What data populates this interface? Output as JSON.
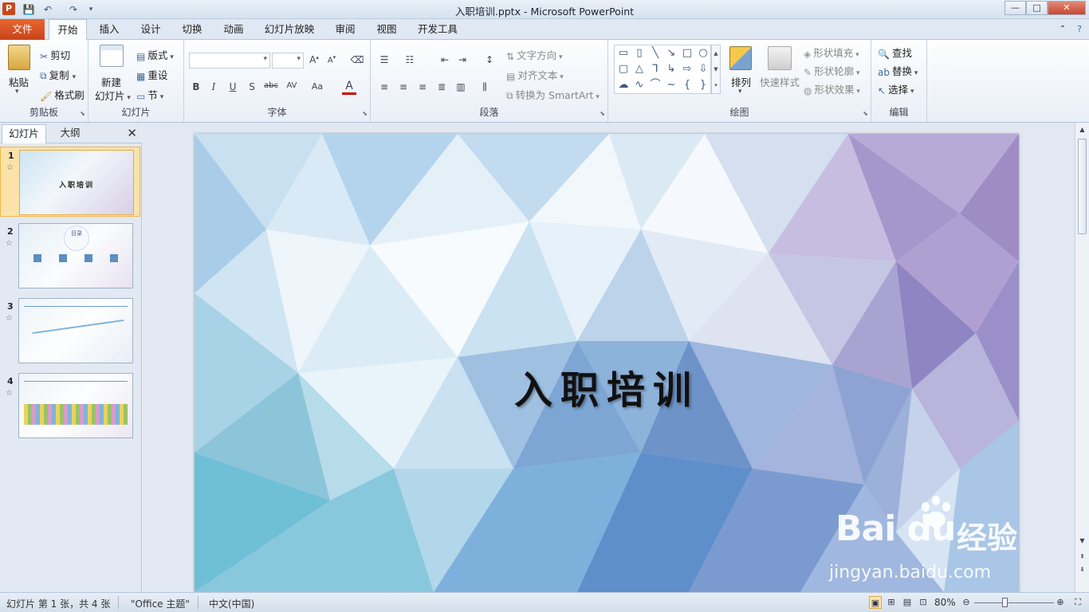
{
  "window": {
    "title": "入职培训.pptx - Microsoft PowerPoint",
    "app_icon_letter": "P",
    "minimize": "—",
    "maximize": "□",
    "close": "✕"
  },
  "tabs": [
    "文件",
    "开始",
    "插入",
    "设计",
    "切换",
    "动画",
    "幻灯片放映",
    "审阅",
    "视图",
    "开发工具"
  ],
  "active_tab": "开始",
  "ribbon": {
    "clipboard": {
      "label": "剪贴板",
      "paste": "粘贴",
      "cut": "剪切",
      "copy": "复制",
      "format_painter": "格式刷"
    },
    "slides": {
      "label": "幻灯片",
      "new_slide_line1": "新建",
      "new_slide_line2": "幻灯片",
      "layout": "版式",
      "reset": "重设",
      "section": "节"
    },
    "font": {
      "label": "字体",
      "font_name": "",
      "font_size": ""
    },
    "paragraph": {
      "label": "段落",
      "text_direction": "文字方向",
      "align_text": "对齐文本",
      "convert_smartart": "转换为 SmartArt"
    },
    "drawing": {
      "label": "绘图",
      "arrange": "排列",
      "quick_styles": "快速样式",
      "shape_fill": "形状填充",
      "shape_outline": "形状轮廓",
      "shape_effects": "形状效果"
    },
    "editing": {
      "label": "编辑",
      "find": "查找",
      "replace": "替换",
      "select": "选择"
    }
  },
  "left_panel": {
    "tab_slides": "幻灯片",
    "tab_outline": "大纲",
    "close": "✕",
    "thumbnails": [
      {
        "number": "1",
        "text": "入职培训",
        "selected": true
      },
      {
        "number": "2",
        "text": "目录",
        "selected": false
      },
      {
        "number": "3",
        "text": "",
        "selected": false
      },
      {
        "number": "4",
        "text": "",
        "selected": false
      }
    ]
  },
  "slide": {
    "title": "入职培训"
  },
  "watermark": {
    "brand": "Bai du",
    "cn": "经验",
    "url": "jingyan.baidu.com"
  },
  "status": {
    "slide_info": "幻灯片 第 1 张，共 4 张",
    "theme": "\"Office 主题\"",
    "language": "中文(中国)",
    "zoom": "80%",
    "zoom_level": 0.8
  },
  "colors": {
    "file_tab": "#d0501f",
    "accent": "#2b579a",
    "slide_selected_border": "#f0b64a"
  }
}
